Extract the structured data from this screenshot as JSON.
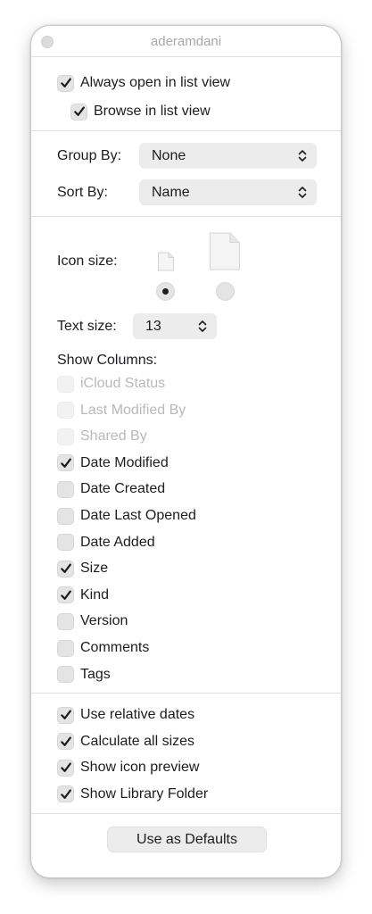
{
  "window": {
    "title": "aderamdani"
  },
  "top_options": {
    "always_open_list": {
      "label": "Always open in list view",
      "checked": true
    },
    "browse_list": {
      "label": "Browse in list view",
      "checked": true
    }
  },
  "group_by": {
    "label": "Group By:",
    "value": "None"
  },
  "sort_by": {
    "label": "Sort By:",
    "value": "Name"
  },
  "icon_size": {
    "label": "Icon size:",
    "selected": "small"
  },
  "text_size": {
    "label": "Text size:",
    "value": "13"
  },
  "columns": {
    "heading": "Show Columns:",
    "items": [
      {
        "label": "iCloud Status",
        "checked": false,
        "enabled": false
      },
      {
        "label": "Last Modified By",
        "checked": false,
        "enabled": false
      },
      {
        "label": "Shared By",
        "checked": false,
        "enabled": false
      },
      {
        "label": "Date Modified",
        "checked": true,
        "enabled": true
      },
      {
        "label": "Date Created",
        "checked": false,
        "enabled": true
      },
      {
        "label": "Date Last Opened",
        "checked": false,
        "enabled": true
      },
      {
        "label": "Date Added",
        "checked": false,
        "enabled": true
      },
      {
        "label": "Size",
        "checked": true,
        "enabled": true
      },
      {
        "label": "Kind",
        "checked": true,
        "enabled": true
      },
      {
        "label": "Version",
        "checked": false,
        "enabled": true
      },
      {
        "label": "Comments",
        "checked": false,
        "enabled": true
      },
      {
        "label": "Tags",
        "checked": false,
        "enabled": true
      }
    ]
  },
  "bottom_options": {
    "items": [
      {
        "label": "Use relative dates",
        "checked": true
      },
      {
        "label": "Calculate all sizes",
        "checked": true
      },
      {
        "label": "Show icon preview",
        "checked": true
      },
      {
        "label": "Show Library Folder",
        "checked": true
      }
    ]
  },
  "defaults_button": {
    "label": "Use as Defaults"
  },
  "icons": {
    "checkbox": "checkmark-icon",
    "popup": "chevron-updown-icon",
    "doc_small": "document-small-icon",
    "doc_large": "document-large-icon"
  }
}
